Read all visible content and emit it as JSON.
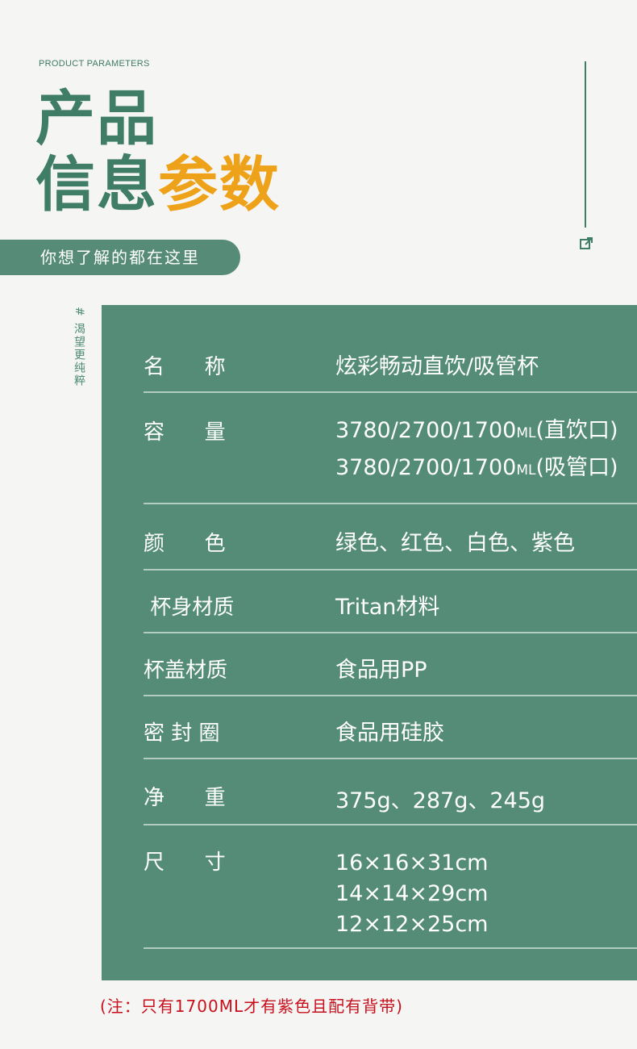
{
  "header": {
    "eyebrow": "PRODUCT PARAMETERS",
    "title_line1": "产品",
    "title_line2_green": "信息",
    "title_line2_orange": "参数",
    "subtitle": "你想了解的都在这里",
    "side_tag": "# 渴望更纯粹",
    "accent_green": "#3f7d67",
    "accent_orange": "#eea21a",
    "icon": "external-link-icon"
  },
  "params": {
    "name": {
      "label": "名      称",
      "value": "炫彩畅动直饮/吸管杯"
    },
    "capacity": {
      "label": "容      量",
      "line1_num": "3780/2700/1700",
      "line1_unit": "ML",
      "line1_suffix": "(直饮口)",
      "line2_num": "3780/2700/1700",
      "line2_unit": "ML",
      "line2_suffix": "(吸管口)"
    },
    "color": {
      "label": "颜      色",
      "value": "绿色、红色、白色、紫色"
    },
    "body_material": {
      "label": " 杯身材质",
      "value": "Tritan材料"
    },
    "lid_material": {
      "label": "杯盖材质",
      "value": "食品用PP"
    },
    "seal": {
      "label": "密 封 圈",
      "value": "食品用硅胶"
    },
    "weight": {
      "label": "净      重",
      "value": "375g、287g、245g"
    },
    "size": {
      "label": "尺      寸",
      "values": [
        "16×16×31cm",
        "14×14×29cm",
        "12×12×25cm"
      ]
    }
  },
  "note": "(注：只有1700ML才有紫色且配有背带)"
}
